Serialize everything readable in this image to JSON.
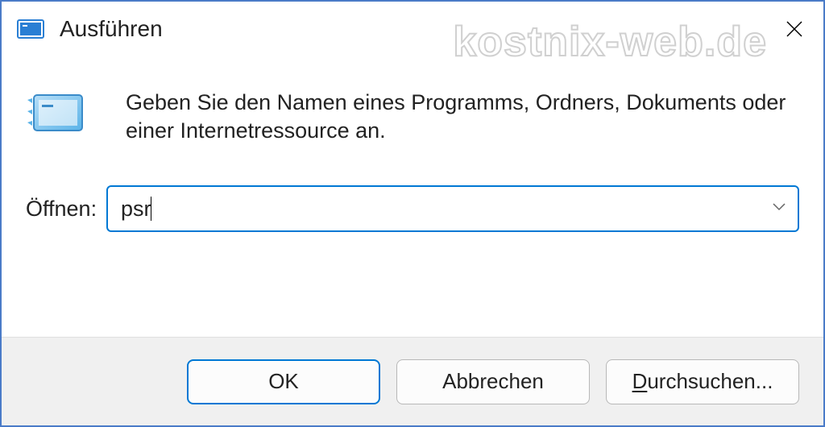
{
  "window": {
    "title": "Ausführen"
  },
  "content": {
    "description": "Geben Sie den Namen eines Programms, Ordners, Dokuments oder einer Internetressource an.",
    "open_label": "Öffnen:",
    "input_value": "psr"
  },
  "buttons": {
    "ok": "OK",
    "cancel": "Abbrechen",
    "browse_prefix": "D",
    "browse_rest": "urchsuchen..."
  },
  "watermark": "kostnix-web.de"
}
